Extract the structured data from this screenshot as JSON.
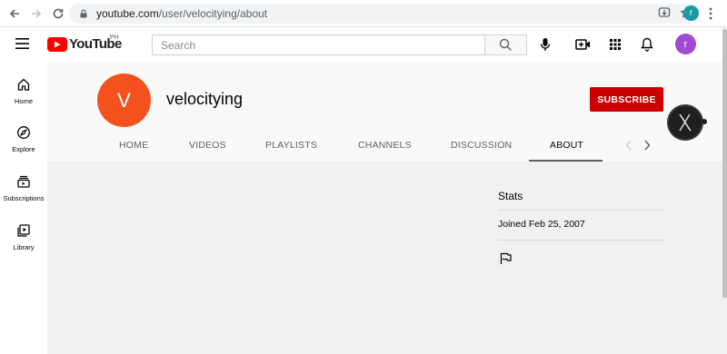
{
  "browser": {
    "url_host": "youtube.com",
    "url_path": "/user/velocitying/about",
    "profile_initial": "r"
  },
  "masthead": {
    "logo_text": "YouTube",
    "region": "PH",
    "search_placeholder": "Search",
    "avatar_initial": "r"
  },
  "guide": {
    "items": [
      {
        "label": "Home",
        "icon": "home-icon"
      },
      {
        "label": "Explore",
        "icon": "compass-icon"
      },
      {
        "label": "Subscriptions",
        "icon": "subscriptions-icon"
      },
      {
        "label": "Library",
        "icon": "library-icon"
      }
    ]
  },
  "channel": {
    "avatar_initial": "V",
    "name": "velocitying",
    "subscribe_label": "SUBSCRIBE",
    "avatar_color": "#f4511e",
    "subscribe_color": "#cc0000"
  },
  "tabs": [
    {
      "label": "HOME"
    },
    {
      "label": "VIDEOS"
    },
    {
      "label": "PLAYLISTS"
    },
    {
      "label": "CHANNELS"
    },
    {
      "label": "DISCUSSION"
    },
    {
      "label": "ABOUT",
      "active": true
    }
  ],
  "about": {
    "stats_title": "Stats",
    "joined": "Joined Feb 25, 2007"
  }
}
